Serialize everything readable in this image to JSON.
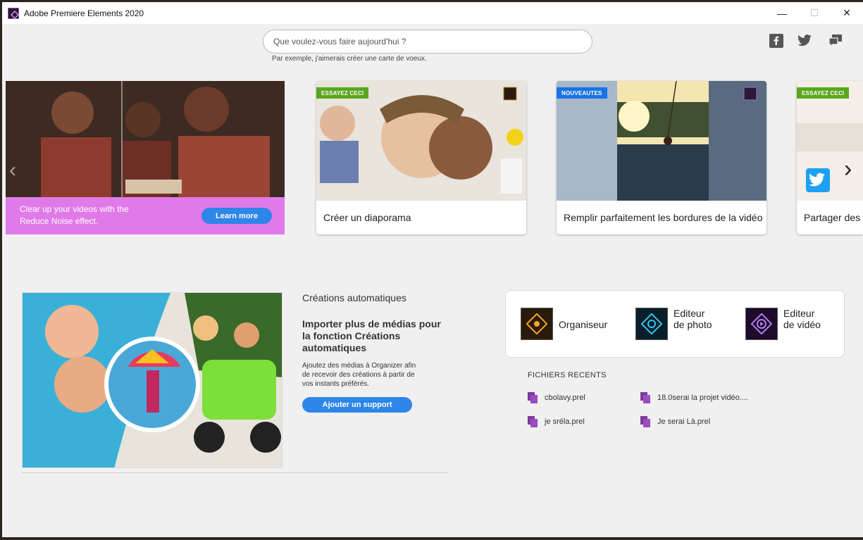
{
  "window": {
    "title": "Adobe Premiere Elements 2020",
    "controls": {
      "minimize": "—",
      "maximize": "☐",
      "close": "✕"
    }
  },
  "search": {
    "placeholder": "Que voulez-vous faire aujourd'hui ?",
    "hint": "Par exemple, j'aimerais créer une carte de voeux."
  },
  "social": [
    "facebook-icon",
    "twitter-icon",
    "feedback-icon"
  ],
  "promo": {
    "text": "Clear up your videos with the Reduce Noise effect.",
    "button": "Learn more",
    "prev_arrow": "‹",
    "next_arrow": "›"
  },
  "cards": [
    {
      "badge": "ESSAYEZ CECI",
      "caption": "Créer un diaporama"
    },
    {
      "badge": "NOUVEAUTES",
      "caption": "Remplir parfaitement les bordures de la vidéo"
    },
    {
      "badge": "ESSAYEZ CECI",
      "caption": "Partager des p"
    }
  ],
  "auto": {
    "title": "Créations automatiques",
    "heading": "Importer plus de médias pour la fonction Créations automatiques",
    "description": "Ajoutez des médias à Organizer afin de recevoir des créations à partir de vos instants préférés.",
    "button": "Ajouter un support"
  },
  "apps": [
    {
      "label": "Organiseur",
      "color": "#f5a623"
    },
    {
      "label": "Editeur de photo",
      "color": "#31c5f0"
    },
    {
      "label": "Editeur de vidéo",
      "color": "#b07cf0"
    }
  ],
  "recent": {
    "title": "FICHIERS RECENTS",
    "items": [
      "cbolavy.prel",
      "18.0serai la projet vidéo....",
      "je sréla.prel",
      "Je serai Là.prel"
    ]
  },
  "colors": {
    "accent": "#2d86e8",
    "promo_band": "#e07ae8",
    "badge_green": "#5aa71e",
    "badge_blue": "#1a73e8"
  }
}
